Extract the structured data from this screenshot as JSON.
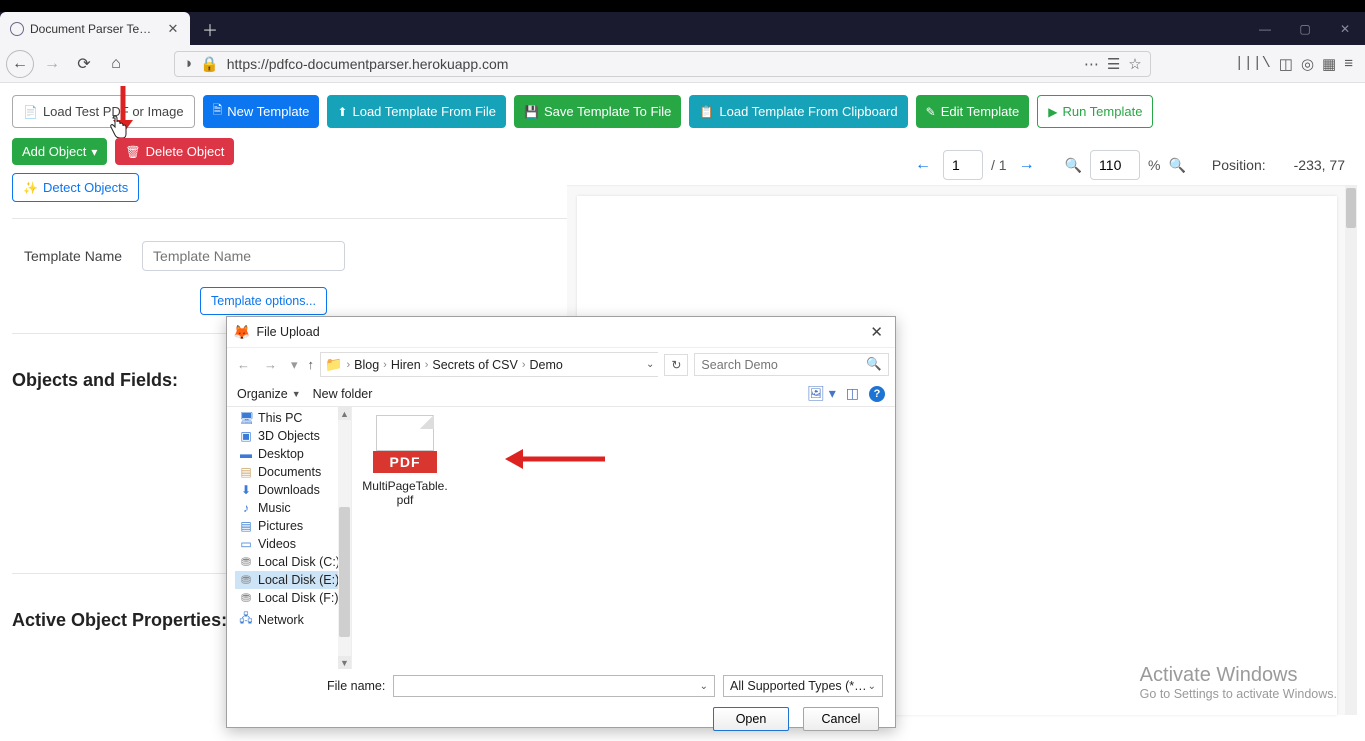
{
  "browser": {
    "tab_title": "Document Parser Template Ed",
    "url": "https://pdfco-documentparser.herokuapp.com"
  },
  "toolbar": {
    "load_test": "Load Test PDF or Image",
    "new_template": "New Template",
    "load_template_file": "Load Template From File",
    "save_template_file": "Save Template To File",
    "load_template_clip": "Load Template From Clipboard",
    "edit_template": "Edit Template",
    "run_template": "Run Template"
  },
  "secondary": {
    "add_object": "Add Object",
    "delete_object": "Delete Object",
    "detect_objects": "Detect Objects"
  },
  "template": {
    "label": "Template Name",
    "placeholder": "Template Name",
    "options": "Template options..."
  },
  "sections": {
    "objects": "Objects and Fields:",
    "properties": "Active Object Properties:"
  },
  "page_ctrl": {
    "page": "1",
    "total": "/ 1",
    "zoom": "110",
    "pct": "%",
    "pos_label": "Position:",
    "pos_val": "-233, 77"
  },
  "file_dialog": {
    "title": "File Upload",
    "breadcrumbs": [
      "Blog",
      "Hiren",
      "Secrets of CSV",
      "Demo"
    ],
    "search_ph": "Search Demo",
    "organize": "Organize",
    "new_folder": "New folder",
    "tree": [
      {
        "label": "This PC",
        "icon": "🖥",
        "color": "#3a7bd5"
      },
      {
        "label": "3D Objects",
        "icon": "▣",
        "color": "#3a7bd5"
      },
      {
        "label": "Desktop",
        "icon": "▬",
        "color": "#3a7bd5"
      },
      {
        "label": "Documents",
        "icon": "▤",
        "color": "#caa46a"
      },
      {
        "label": "Downloads",
        "icon": "⬇",
        "color": "#3a7bd5"
      },
      {
        "label": "Music",
        "icon": "♪",
        "color": "#3a7bd5"
      },
      {
        "label": "Pictures",
        "icon": "▤",
        "color": "#3a7bd5"
      },
      {
        "label": "Videos",
        "icon": "▭",
        "color": "#3a7bd5"
      },
      {
        "label": "Local Disk (C:)",
        "icon": "⛃",
        "color": "#888"
      },
      {
        "label": "Local Disk (E:)",
        "icon": "⛃",
        "color": "#888",
        "selected": true
      },
      {
        "label": "Local Disk (F:)",
        "icon": "⛃",
        "color": "#888"
      },
      {
        "label": "Network",
        "icon": "🖧",
        "color": "#3a7bd5"
      }
    ],
    "file": {
      "name": "MultiPageTable.pdf",
      "band": "PDF"
    },
    "fn_label": "File name:",
    "type_filter": "All Supported Types (*.pdf;*.jpg",
    "open": "Open",
    "cancel": "Cancel"
  },
  "watermark": {
    "h": "Activate Windows",
    "s": "Go to Settings to activate Windows."
  }
}
